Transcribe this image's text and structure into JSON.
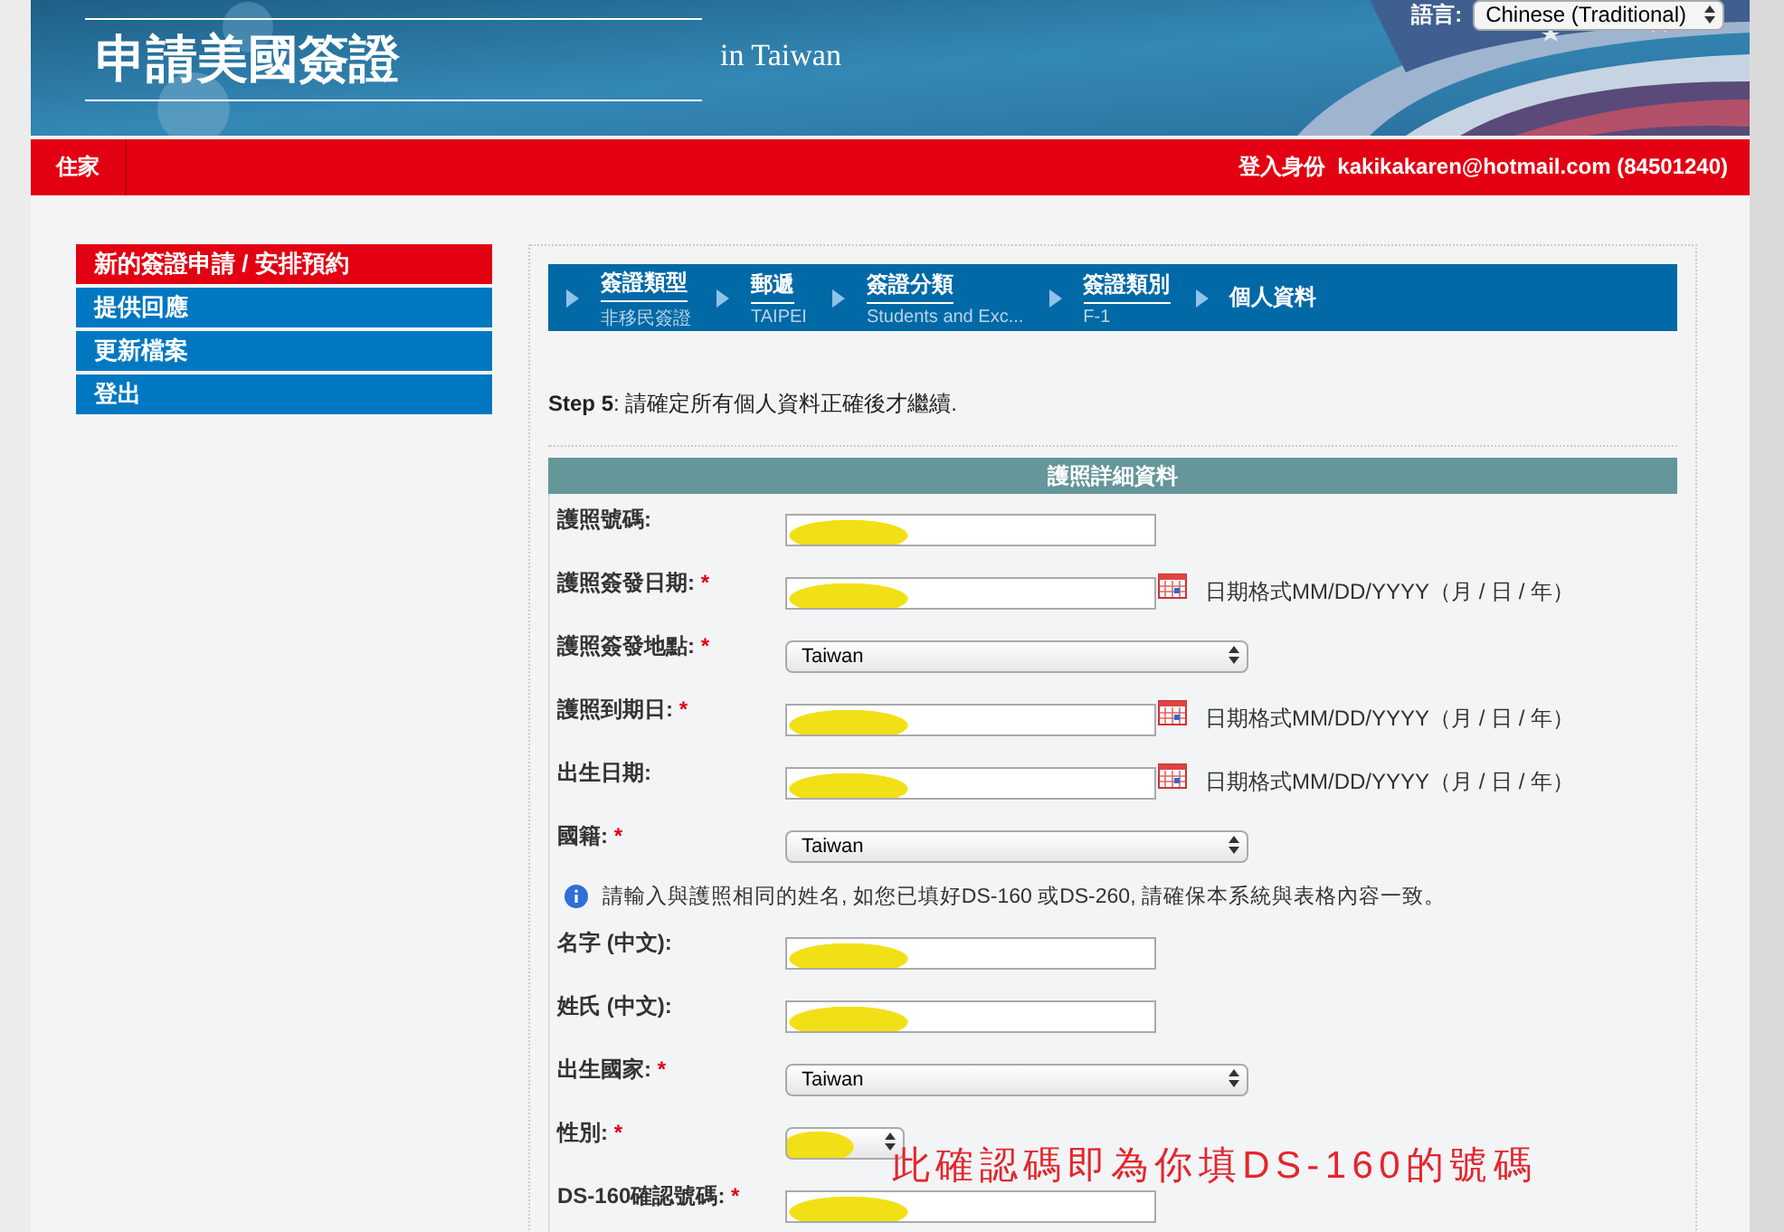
{
  "header": {
    "title": "申請美國簽證",
    "subtitle": "in Taiwan",
    "language_label": "語言:",
    "language": "Chinese (Traditional)"
  },
  "nav_bar": {
    "home": "住家",
    "login_label": "登入身份",
    "account": "kakikakaren@hotmail.com (84501240)"
  },
  "sidebar": {
    "items": [
      {
        "label": "新的簽證申請 / 安排預約",
        "selected": true
      },
      {
        "label": "提供回應",
        "selected": false
      },
      {
        "label": "更新檔案",
        "selected": false
      },
      {
        "label": "登出",
        "selected": false
      }
    ]
  },
  "steps": [
    {
      "title": "簽證類型",
      "value": "非移民簽證"
    },
    {
      "title": "郵遞",
      "value": "TAIPEI"
    },
    {
      "title": "簽證分類",
      "value": "Students and Exc..."
    },
    {
      "title": "簽證類別",
      "value": "F-1"
    },
    {
      "title": "個人資料"
    }
  ],
  "instruction": "**Step 5**: 請確定所有個人資料正確後才繼續.",
  "form": {
    "title": "護照詳細資料",
    "rows": [
      {
        "kind": "text",
        "label": "護照號碼:",
        "redacted": true
      },
      {
        "kind": "date",
        "label": "護照簽發日期:",
        "required_mark": "*",
        "redacted": true,
        "hint": "日期格式MM/DD/YYYY（月 / 日 / 年）"
      },
      {
        "kind": "select",
        "label": "護照簽發地點:",
        "required_mark": "*",
        "value": "Taiwan"
      },
      {
        "kind": "date",
        "label": "護照到期日:",
        "required_mark": "*",
        "redacted": true,
        "hint": "日期格式MM/DD/YYYY（月 / 日 / 年）"
      },
      {
        "kind": "date",
        "label": "出生日期:",
        "redacted": true,
        "hint": "日期格式MM/DD/YYYY（月 / 日 / 年）"
      },
      {
        "kind": "select",
        "label": "國籍:",
        "required_mark": "*",
        "value": "Taiwan"
      },
      {
        "kind": "info",
        "text": "請輸入與護照相同的姓名, 如您已填好DS-160 或DS-260, 請確保本系統與表格內容一致。"
      },
      {
        "kind": "text",
        "label": "名字 (中文):",
        "redacted": true
      },
      {
        "kind": "text",
        "label": "姓氏 (中文):",
        "redacted": true
      },
      {
        "kind": "select",
        "label": "出生國家:",
        "required_mark": "*",
        "value": "Taiwan"
      },
      {
        "kind": "small-select",
        "label": "性別:",
        "required_mark": "*",
        "redacted": true
      },
      {
        "kind": "text",
        "label": "DS-160確認號碼:",
        "required_mark": "*",
        "redacted": true
      }
    ]
  },
  "annotation": "此確認碼即為你填DS-160的號碼"
}
